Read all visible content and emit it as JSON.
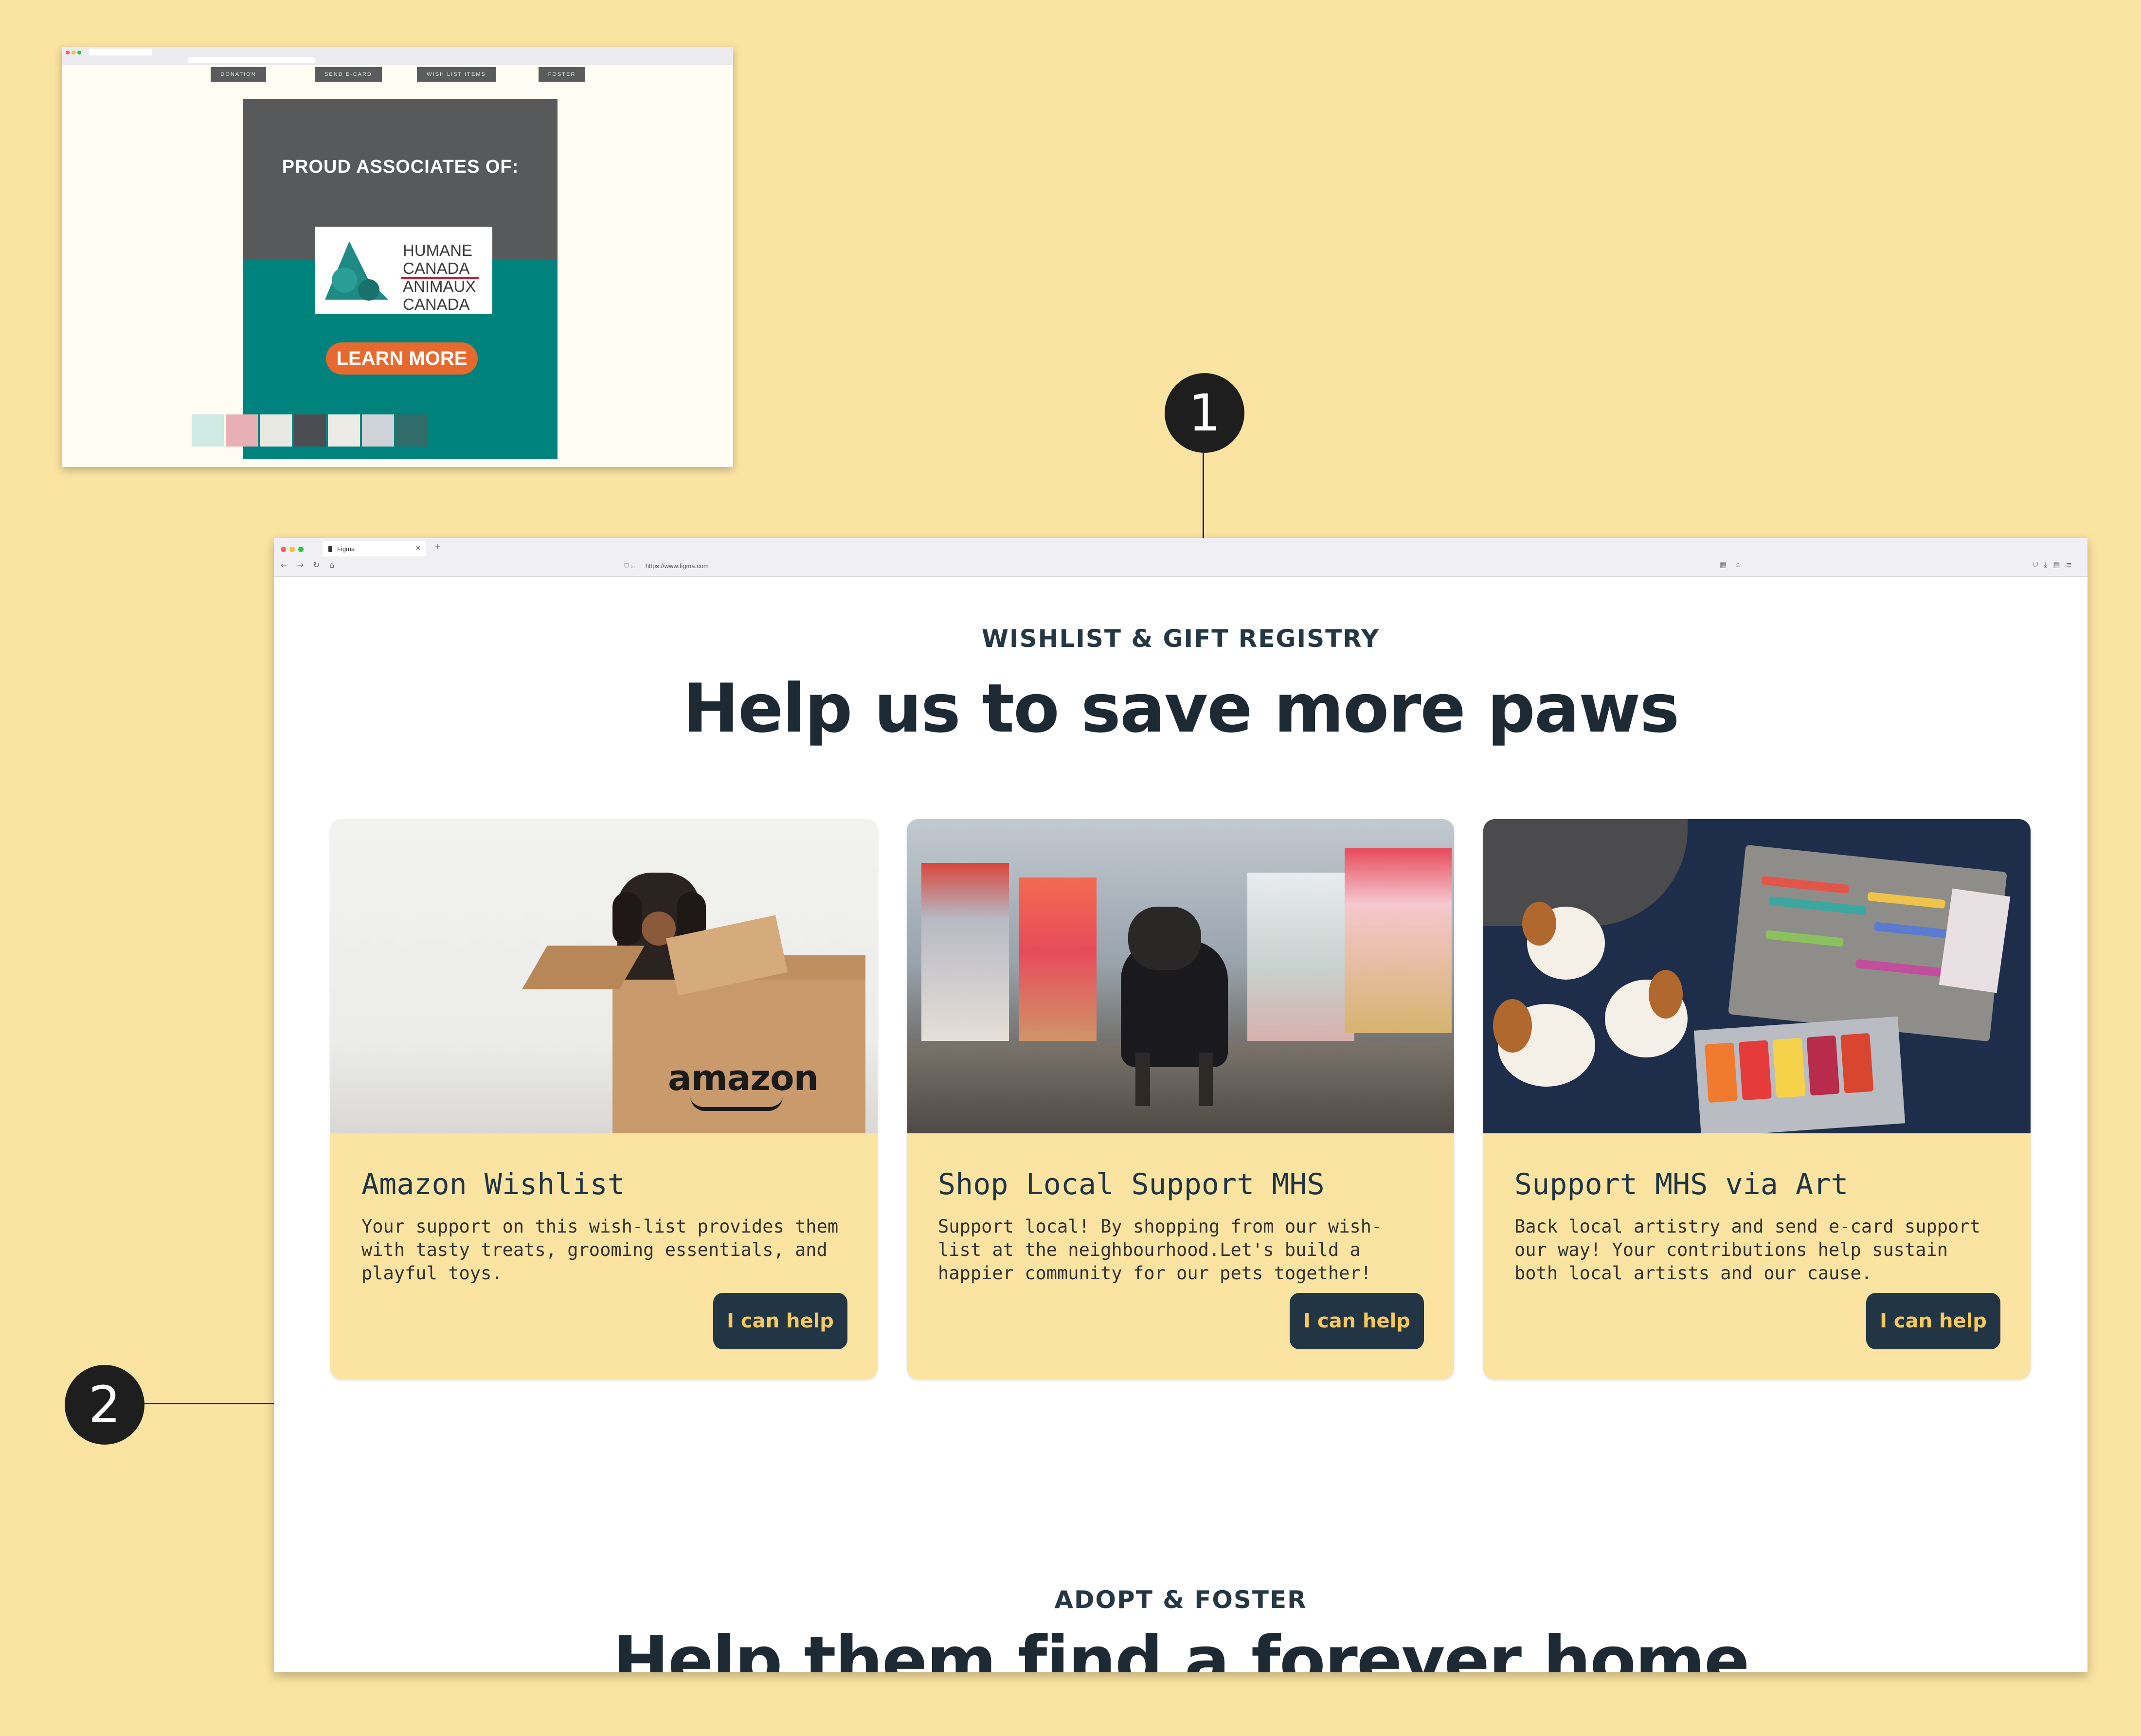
{
  "mini_window": {
    "nav": [
      "DONATION",
      "SEND E-CARD",
      "WISH LIST ITEMS",
      "FOSTER"
    ],
    "banner_title": "PROUD ASSOCIATES OF:",
    "logo_lines": [
      "HUMANE",
      "CANADA",
      "ANIMAUX",
      "CANADA"
    ],
    "cta": "LEARN MORE",
    "thumb_colors": [
      "#cfe9e3",
      "#e8b0b4",
      "#e9e9e4",
      "#4c4d52",
      "#ecebe6",
      "#cfd2d8",
      "#2f6c6a"
    ]
  },
  "callouts": [
    "1",
    "2"
  ],
  "browser": {
    "tab_title": "Figma",
    "url": "https://www.figma.com"
  },
  "section": {
    "eyebrow": "WISHLIST & GIFT REGISTRY",
    "headline": "Help us to save more paws",
    "cards": [
      {
        "title": "Amazon Wishlist",
        "desc": "Your support on this wish-list provides them with tasty treats, grooming essentials, and playful toys.",
        "button": "I can help",
        "image_label": "amazon"
      },
      {
        "title": "Shop Local Support MHS",
        "desc": "Support local! By shopping from our wish-list at the neighbourhood.Let's build a happier community for our pets together!",
        "button": "I can help"
      },
      {
        "title": "Support MHS via Art",
        "desc": "Back local artistry and send e-card support our way! Your contributions help sustain both local artists and our cause.",
        "button": "I can help"
      }
    ]
  },
  "next_section": {
    "eyebrow": "ADOPT & FOSTER",
    "headline": "Help them find a forever home"
  },
  "colors": {
    "background": "#fbe3a1",
    "card": "#fbe3a1",
    "button": "#223544",
    "button_text": "#f6c95a",
    "banner_gray": "#58595b",
    "banner_teal": "#00837c",
    "cta_orange": "#e66a2e"
  }
}
